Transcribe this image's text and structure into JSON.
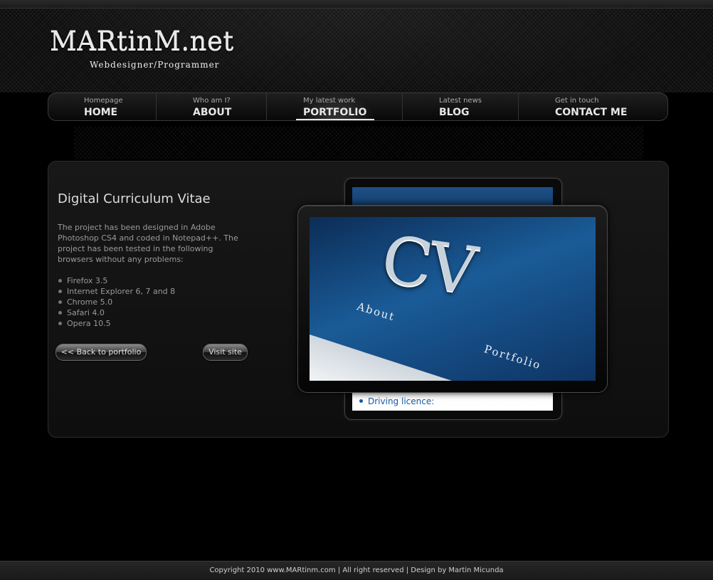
{
  "logo": {
    "main": "MARtinM.net",
    "sub": "Webdesigner/Programmer"
  },
  "nav": [
    {
      "small": "Homepage",
      "label": "HOME"
    },
    {
      "small": "Who am I?",
      "label": "ABOUT"
    },
    {
      "small": "My latest work",
      "label": "PORTFOLIO",
      "active": true
    },
    {
      "small": "Latest news",
      "label": "BLOG"
    },
    {
      "small": "Get in touch",
      "label": "CONTACT ME"
    }
  ],
  "project": {
    "title": "Digital Curriculum Vitae",
    "description": "The project has been designed in Adobe Photoshop CS4 and coded in Notepad++. The project has been tested in the following browsers without any problems:",
    "browsers": [
      "Firefox 3.5",
      "Internet Explorer 6, 7 and 8",
      "Chrome 5.0",
      "Safari 4.0",
      "Opera 10.5"
    ],
    "back_button": "<< Back to portfolio",
    "visit_button": "Visit site"
  },
  "preview": {
    "cv_text": "CV",
    "about_text": "About",
    "portfolio_text": "Portfolio",
    "driving_text": "Driving licence:"
  },
  "footer": {
    "text": "Copyright 2010 www.MARtinm.com | All right reserved | Design by Martin Micunda"
  },
  "colors": {
    "background": "#000000",
    "preview_blue": "#1a5b97",
    "text_grey": "#9a9a9a"
  }
}
